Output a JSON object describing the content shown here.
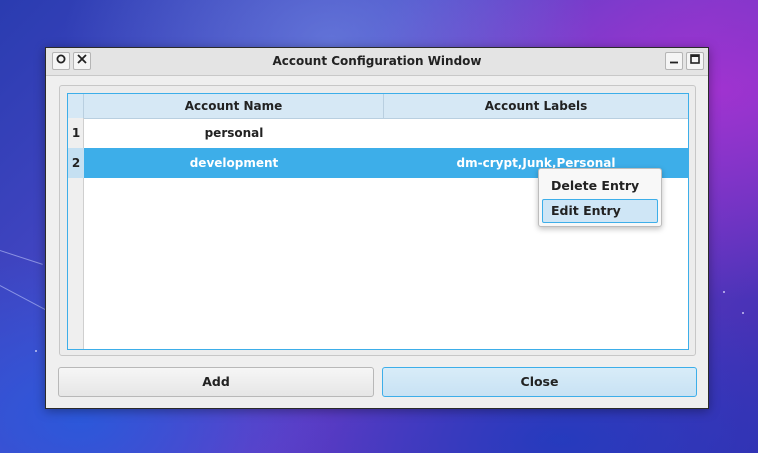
{
  "window": {
    "title": "Account Configuration Window"
  },
  "table": {
    "columns": [
      "Account Name",
      "Account Labels"
    ],
    "rows": [
      {
        "index": "1",
        "name": "personal",
        "labels": "",
        "selected": false
      },
      {
        "index": "2",
        "name": "development",
        "labels": "dm-crypt,Junk,Personal",
        "selected": true
      }
    ]
  },
  "context_menu": {
    "items": [
      {
        "label": "Delete Entry",
        "highlighted": false
      },
      {
        "label": "Edit Entry",
        "highlighted": true
      }
    ]
  },
  "buttons": {
    "add": "Add",
    "close": "Close"
  },
  "colors": {
    "accent": "#3daee9",
    "selection_text": "#ffffff"
  },
  "icons": {
    "titlebar_left": [
      "pin-icon",
      "close-icon"
    ],
    "titlebar_right": [
      "minimize-icon",
      "maximize-icon"
    ]
  }
}
